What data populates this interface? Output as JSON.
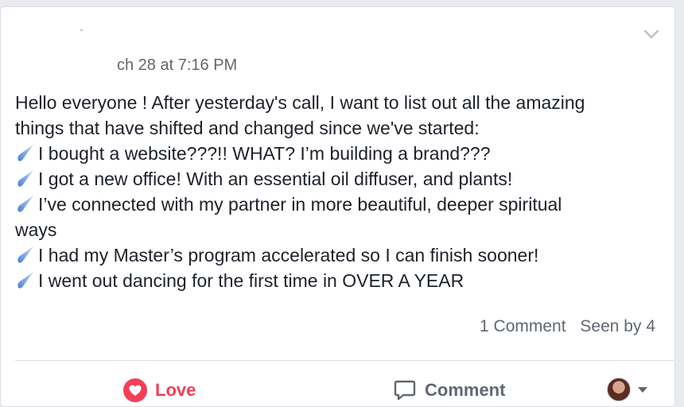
{
  "post": {
    "timestamp": "ch 28 at 7:16 PM",
    "intro_line1": "Hello everyone ! After yesterday's call, I want to list out all the amazing",
    "intro_line2": "things that have shifted and changed since we've started:",
    "items": [
      {
        "text": "I bought a website???!! WHAT? I’m building a brand???"
      },
      {
        "text": "I got a new office! With an essential oil diffuser, and plants!"
      },
      {
        "text": "I’ve connected with my partner in more beautiful, deeper spiritual"
      },
      {
        "text": "I had my Master’s program accelerated so I can finish sooner!"
      },
      {
        "text": "I went out dancing for the first time in OVER A YEAR"
      }
    ],
    "item3_continuation": "ways",
    "bullet_icon": "comet-icon"
  },
  "stats": {
    "comments": "1 Comment",
    "seen_by": "Seen by 4"
  },
  "actions": {
    "love_label": "Love",
    "comment_label": "Comment"
  },
  "colors": {
    "love": "#f33e58",
    "secondary_text": "#606770",
    "bullet_blue": "#5b8fd6"
  }
}
